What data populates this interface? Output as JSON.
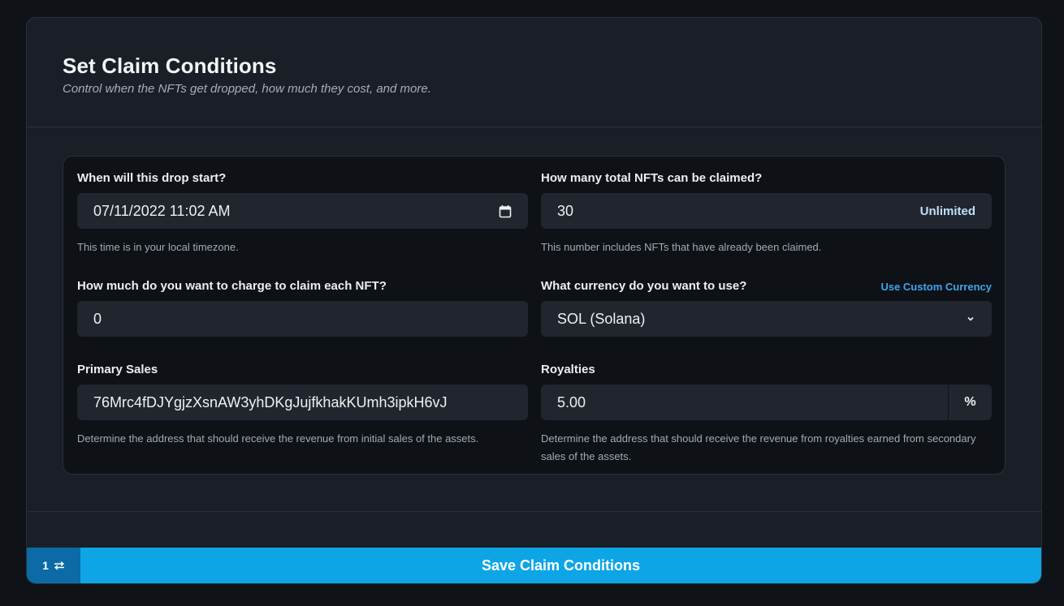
{
  "header": {
    "title": "Set Claim Conditions",
    "subtitle": "Control when the NFTs get dropped, how much they cost, and more."
  },
  "fields": {
    "start": {
      "label": "When will this drop start?",
      "value": "07/11/2022 11:02 AM",
      "helper": "This time is in your local timezone.",
      "icon": "calendar-icon"
    },
    "total": {
      "label": "How many total NFTs can be claimed?",
      "value": "30",
      "action": "Unlimited",
      "helper": "This number includes NFTs that have already been claimed."
    },
    "price": {
      "label": "How much do you want to charge to claim each NFT?",
      "value": "0"
    },
    "currency": {
      "label": "What currency do you want to use?",
      "link": "Use Custom Currency",
      "value": "SOL (Solana)",
      "icon": "chevron-down-icon"
    },
    "primary": {
      "label": "Primary Sales",
      "value": "76Mrc4fDJYgjzXsnAW3yhDKgJujfkhakKUmh3ipkH6vJ",
      "helper": "Determine the address that should receive the revenue from initial sales of the assets."
    },
    "royalties": {
      "label": "Royalties",
      "value": "5.00",
      "suffix": "%",
      "helper": "Determine the address that should receive the revenue from royalties earned from secondary sales of the assets."
    }
  },
  "footer": {
    "count": "1",
    "count_icon": "swap-arrows-icon",
    "save_label": "Save Claim Conditions"
  },
  "colors": {
    "background": "#0f1217",
    "card": "#1a1f27",
    "form_box": "#0e1116",
    "input": "#21262e",
    "accent": "#0ea5e6",
    "accent_dark": "#0c6aa6",
    "link": "#3ea6ee"
  }
}
